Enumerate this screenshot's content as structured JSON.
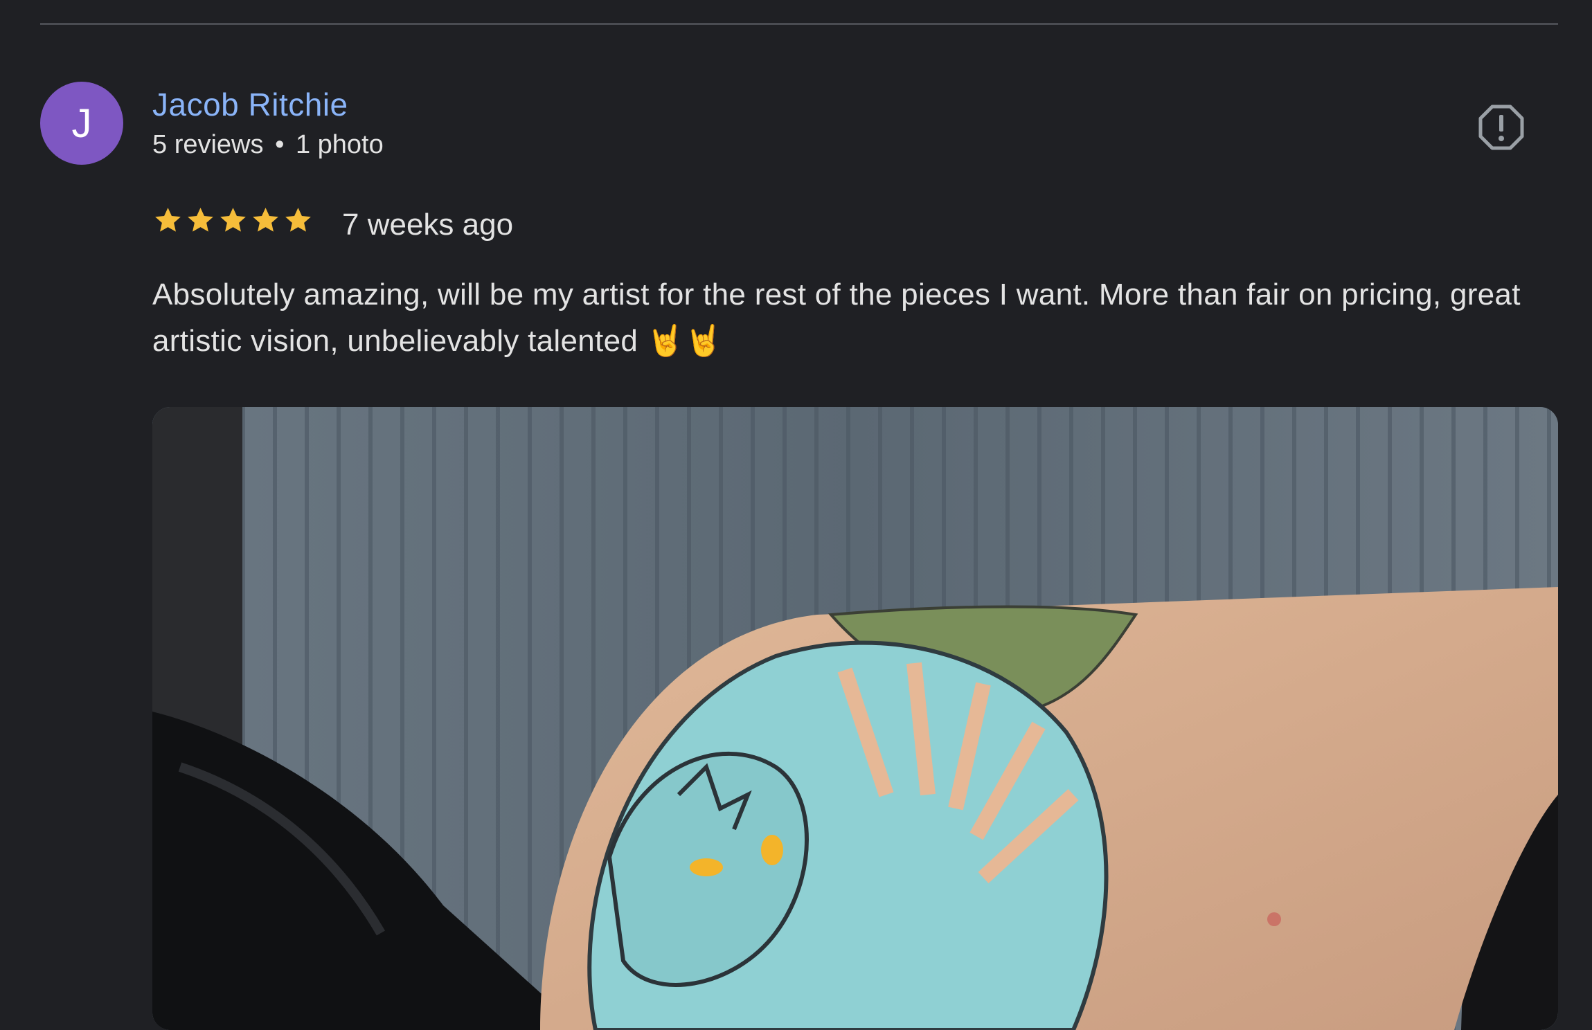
{
  "review": {
    "avatar_letter": "J",
    "reviewer_name": "Jacob Ritchie",
    "reviewer_stats": {
      "reviews": "5 reviews",
      "separator": "•",
      "photos": "1 photo"
    },
    "rating": 5,
    "rating_max": 5,
    "time_ago": "7 weeks ago",
    "text": "Absolutely amazing, will be my artist for the rest of the pieces I want. More than fair on pricing, great artistic vision, unbelievably talented 🤘🤘",
    "icons": {
      "report": "report-flag-icon",
      "star": "star-icon"
    },
    "colors": {
      "avatar_bg": "#7e57c2",
      "name": "#8ab4f8",
      "star": "#f6bd3a",
      "background": "#1f2024"
    }
  }
}
